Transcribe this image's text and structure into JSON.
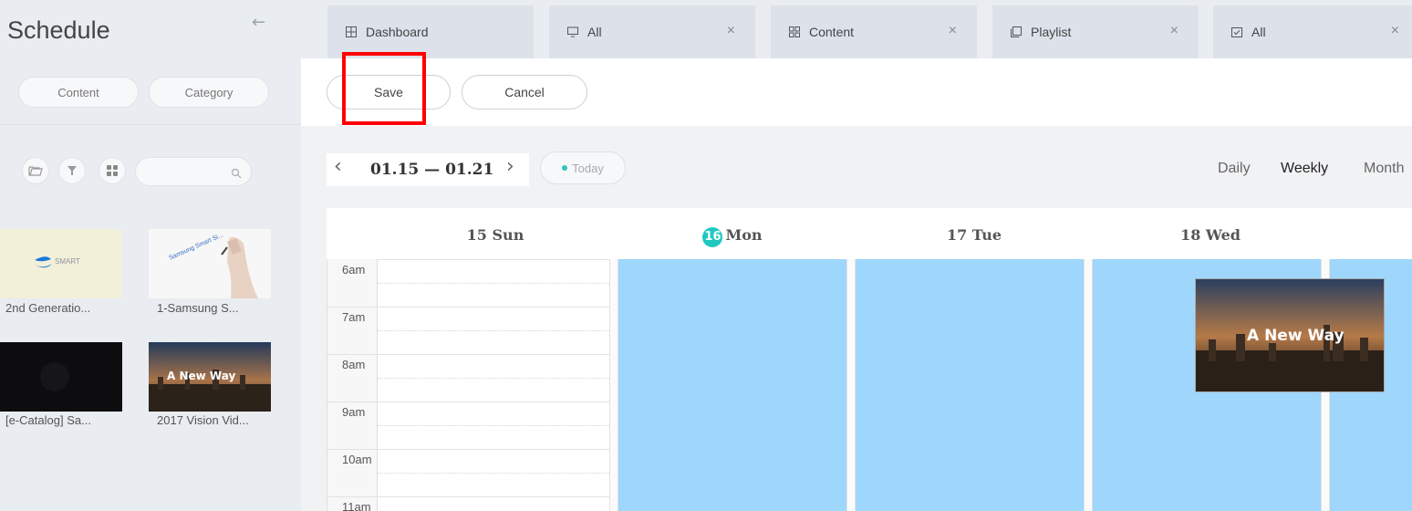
{
  "sidebar": {
    "title": "Schedule",
    "back_icon": "arrow-left-icon",
    "filter_buttons": {
      "content": "Content",
      "category": "Category"
    },
    "tools": [
      "folder-icon",
      "filter-icon",
      "grid-icon"
    ],
    "search": {
      "placeholder": "",
      "value": ""
    },
    "thumbnails": [
      {
        "label": "2nd Generatio...",
        "thumb_text": "SMART"
      },
      {
        "label": "1-Samsung S...",
        "thumb_text": "Samsung Smart Si..."
      },
      {
        "label": "[e-Catalog] Sa...",
        "thumb_text": ""
      },
      {
        "label": "2017 Vision Vid...",
        "thumb_text": "A New Way"
      }
    ]
  },
  "tabs": [
    {
      "label": "Dashboard",
      "icon": "dashboard-icon",
      "closable": false
    },
    {
      "label": "All",
      "icon": "monitor-icon",
      "closable": true
    },
    {
      "label": "Content",
      "icon": "content-grid-icon",
      "closable": true
    },
    {
      "label": "Playlist",
      "icon": "playlist-icon",
      "closable": true
    },
    {
      "label": "All",
      "icon": "schedule-icon",
      "closable": true
    }
  ],
  "toolbar": {
    "save_label": "Save",
    "cancel_label": "Cancel"
  },
  "calendar": {
    "range": "01.15 — 01.21",
    "today_label": "Today",
    "views": [
      "Daily",
      "Weekly",
      "Month"
    ],
    "active_view": "Weekly",
    "days": [
      {
        "num": "15",
        "name": "Sun",
        "today": false
      },
      {
        "num": "16",
        "name": "Mon",
        "today": true
      },
      {
        "num": "17",
        "name": "Tue",
        "today": false
      },
      {
        "num": "18",
        "name": "Wed",
        "today": false
      }
    ],
    "hours": [
      "6am",
      "7am",
      "8am",
      "9am",
      "10am",
      "11am"
    ],
    "event": {
      "title": "A New Way"
    }
  },
  "colors": {
    "accent": "#20c9c0",
    "slot_blue": "#9fd6fb",
    "highlight": "#ff0000"
  }
}
